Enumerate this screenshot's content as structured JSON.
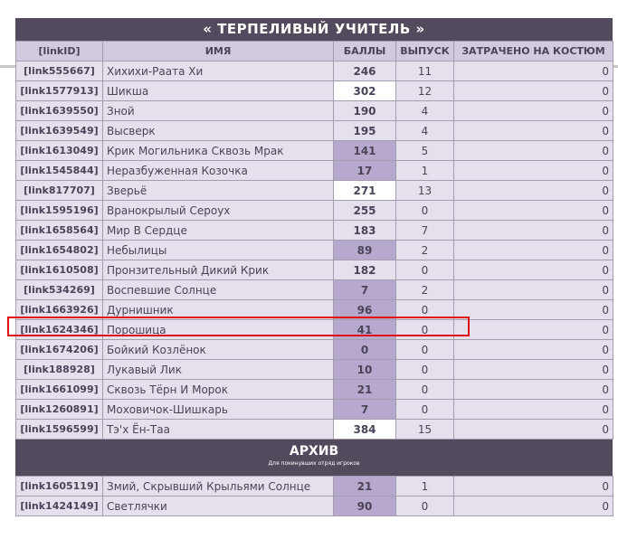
{
  "title": "« ТЕРПЕЛИВЫЙ УЧИТЕЛЬ »",
  "headers": [
    "[linkID]",
    "ИМЯ",
    "БАЛЛЫ",
    "ВЫПУСК",
    "ЗАТРАЧЕНО НА КОСТЮМ"
  ],
  "rows": [
    {
      "id": "[link555667]",
      "name": "Хихихи-Раата Хи",
      "points": "246",
      "release": "11",
      "cost": "0",
      "shade": "none"
    },
    {
      "id": "[link1577913]",
      "name": "Шикша",
      "points": "302",
      "release": "12",
      "cost": "0",
      "shade": "white"
    },
    {
      "id": "[link1639550]",
      "name": "Зной",
      "points": "190",
      "release": "4",
      "cost": "0",
      "shade": "none"
    },
    {
      "id": "[link1639549]",
      "name": "Высверк",
      "points": "195",
      "release": "4",
      "cost": "0",
      "shade": "none"
    },
    {
      "id": "[link1613049]",
      "name": "Крик Могильника Сквозь Мрак",
      "points": "141",
      "release": "5",
      "cost": "0",
      "shade": "purple"
    },
    {
      "id": "[link1545844]",
      "name": "Неразбуженная Козочка",
      "points": "17",
      "release": "1",
      "cost": "0",
      "shade": "purple"
    },
    {
      "id": "[link817707]",
      "name": "Зверьё",
      "points": "271",
      "release": "13",
      "cost": "0",
      "shade": "white"
    },
    {
      "id": "[link1595196]",
      "name": "Вранокрылый Сероух",
      "points": "255",
      "release": "0",
      "cost": "0",
      "shade": "none"
    },
    {
      "id": "[link1658564]",
      "name": "Мир В Сердце",
      "points": "183",
      "release": "7",
      "cost": "0",
      "shade": "none"
    },
    {
      "id": "[link1654802]",
      "name": "Небылицы",
      "points": "89",
      "release": "2",
      "cost": "0",
      "shade": "purple"
    },
    {
      "id": "[link1610508]",
      "name": "Пронзительный Дикий Крик",
      "points": "182",
      "release": "0",
      "cost": "0",
      "shade": "none"
    },
    {
      "id": "[link534269]",
      "name": "Воспевшие Солнце",
      "points": "7",
      "release": "2",
      "cost": "0",
      "shade": "purple"
    },
    {
      "id": "[link1663926]",
      "name": "Дурнишник",
      "points": "96",
      "release": "0",
      "cost": "0",
      "shade": "purple"
    },
    {
      "id": "[link1624346]",
      "name": "Порошица",
      "points": "41",
      "release": "0",
      "cost": "0",
      "shade": "purple"
    },
    {
      "id": "[link1674206]",
      "name": "Бойкий Козлёнок",
      "points": "0",
      "release": "0",
      "cost": "0",
      "shade": "purple"
    },
    {
      "id": "[link188928]",
      "name": "Лукавый Лик",
      "points": "10",
      "release": "0",
      "cost": "0",
      "shade": "purple"
    },
    {
      "id": "[link1661099]",
      "name": "Сквозь Тёрн И Морок",
      "points": "21",
      "release": "0",
      "cost": "0",
      "shade": "purple"
    },
    {
      "id": "[link1260891]",
      "name": "Моховичок-Шишкарь",
      "points": "7",
      "release": "0",
      "cost": "0",
      "shade": "purple"
    },
    {
      "id": "[link1596599]",
      "name": "Тэ'х Ён-Таа",
      "points": "384",
      "release": "15",
      "cost": "0",
      "shade": "white"
    }
  ],
  "archive": {
    "title": "АРХИВ",
    "subtitle": "Для покинувших отряд игроков",
    "rows": [
      {
        "id": "[link1605119]",
        "name": "Змий, Скрывший Крыльями Солнце",
        "points": "21",
        "release": "1",
        "cost": "0",
        "shade": "purple"
      },
      {
        "id": "[link1424149]",
        "name": "Светлячки",
        "points": "90",
        "release": "0",
        "cost": "0",
        "shade": "purple"
      }
    ]
  },
  "colors": {
    "header_bg": "#534a5e",
    "row_bg": "#e6e0ec",
    "col_header_bg": "#d2cbe0",
    "points_purple": "#b7a9cd",
    "highlight": "#e01010"
  }
}
